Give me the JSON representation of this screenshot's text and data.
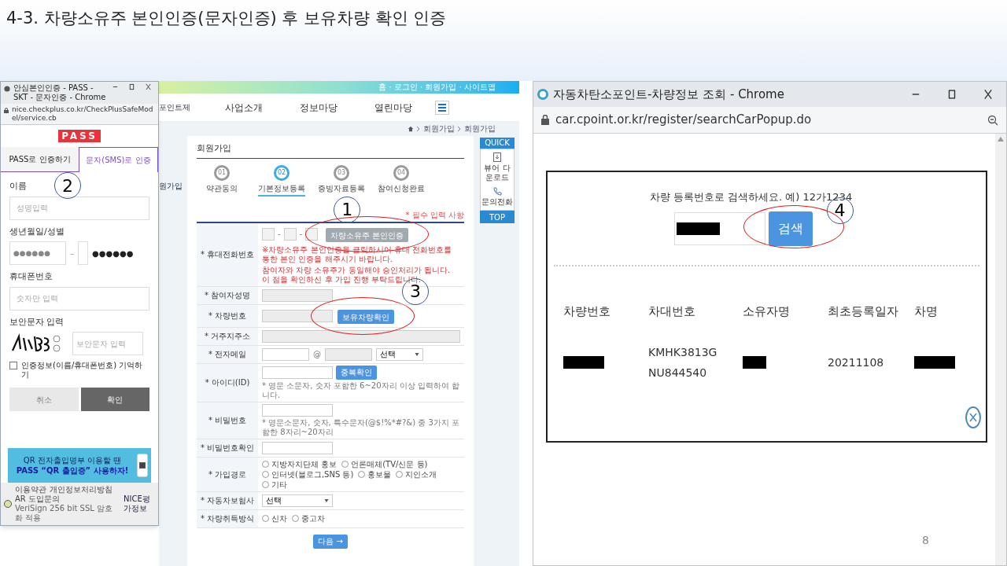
{
  "slide_title": "4-3. 차량소유주 본인인증(문자인증) 후 보유차량 확인 인증",
  "page_number": "8",
  "pass_popup": {
    "title": "안심본인인증 - PASS - SKT - 문자인증 - Chrome",
    "url": "nice.checkplus.co.kr/CheckPlusSafeModel/service.cb",
    "logo": "PASS",
    "marker": "2",
    "tabs": [
      {
        "label": "PASS로 인증하기",
        "selected": false
      },
      {
        "label": "문자(SMS)로 인증",
        "selected": true
      }
    ],
    "fields": [
      {
        "kind": "text",
        "label": "이름",
        "placeholder": "성명입력"
      },
      {
        "kind": "birth",
        "label": "생년월일/성별",
        "placeholder": "●●●●●●",
        "separator": "–",
        "masked": "●●●●●●"
      },
      {
        "kind": "text",
        "label": "휴대폰번호",
        "placeholder": "숫자만 입력"
      },
      {
        "kind": "captcha",
        "label": "보안문자 입력",
        "placeholder": "보안문자 입력"
      }
    ],
    "remember": {
      "label": "인증정보(이름/휴대폰번호) 기억하기",
      "checked": false
    },
    "buttons": [
      {
        "label": "취소",
        "kind": "secondary"
      },
      {
        "label": "확인",
        "kind": "primary"
      }
    ],
    "banner": {
      "line1": "QR 전자출입명부 이용할 땐",
      "line2": "PASS “QR 출입증” 사용하자!"
    },
    "footer": {
      "links": [
        "이용약관",
        "개인정보처리방침",
        "AR 도입문의"
      ],
      "ssl": "VeriSign 256 bit SSL 암호화 적용",
      "brand": "NICE평가정보"
    }
  },
  "site": {
    "top_links": "홈 · 로그인 · 회원가입 · 사이트맵",
    "nav": [
      "포인트제",
      "사업소개",
      "정보마당",
      "열린마당"
    ],
    "breadcrumb": [
      "회원가입",
      "회원가입"
    ],
    "side_title": "원가입",
    "heading": "회원가입",
    "steps": [
      {
        "number": "01",
        "label": "약관동의",
        "selected": false
      },
      {
        "number": "02",
        "label": "기본정보등록",
        "selected": true
      },
      {
        "number": "03",
        "label": "증빙자료등록",
        "selected": false
      },
      {
        "number": "04",
        "label": "참여신청완료",
        "selected": false
      }
    ],
    "quick": {
      "title": "QUICK",
      "items": [
        "뷰어 다운로드",
        "문의전화"
      ],
      "top": "TOP"
    },
    "required_note": "* 필수 입력 사항",
    "rows": [
      {
        "label": "* 휴대전화번호",
        "kind": "phone",
        "separator": "-",
        "button": {
          "label": "차량소유주 본인인증",
          "disabled": true
        },
        "marker": "1",
        "notes": [
          "※차량소유주 본인인증을 클릭하시어 휴대 전화번호를 통한 본인 인증을 해주시기 바랍니다.",
          "참여자와 차량 소유주가 동일해야 승인처리가 됩니다. 이 점을 확인하신 후 가입 진행 부탁드립니다."
        ]
      },
      {
        "label": "* 참여자성명",
        "kind": "readonly"
      },
      {
        "label": "* 차량번호",
        "kind": "readonly",
        "button": {
          "label": "보유차량확인",
          "disabled": false
        },
        "marker": "3"
      },
      {
        "label": "* 거주지주소",
        "kind": "wide"
      },
      {
        "label": "* 전자메일",
        "kind": "email",
        "at": "@",
        "select": "선택"
      },
      {
        "label": "* 아이디(ID)",
        "kind": "input",
        "button": {
          "label": "중복확인",
          "disabled": false
        },
        "hint": "* 영문 소문자, 숫자 포함한 6~20자리 이상 입력하여 합니다."
      },
      {
        "label": "* 비밀번호",
        "kind": "input",
        "hint": "* 영문소문자, 숫자, 특수문자(@$!%*#?&) 중 3가지 포함한 8자리~20자리"
      },
      {
        "label": "* 비밀번호확인",
        "kind": "input"
      },
      {
        "label": "* 가입경로",
        "kind": "radios",
        "options": [
          {
            "label": "지방자치단체 홍보",
            "selected": false
          },
          {
            "label": "언론매체(TV/신문 등)",
            "selected": false
          },
          {
            "label": "인터넷(블로그,SNS 등)",
            "selected": false
          },
          {
            "label": "홍보물",
            "selected": false
          },
          {
            "label": "지인소개",
            "selected": false
          },
          {
            "label": "기타",
            "selected": false
          }
        ]
      },
      {
        "label": "* 자동차보험사",
        "kind": "select",
        "select": "선택"
      },
      {
        "label": "* 차량취득방식",
        "kind": "radios",
        "options": [
          {
            "label": "신차",
            "selected": false
          },
          {
            "label": "중고차",
            "selected": false
          }
        ]
      }
    ],
    "next_button": "다음 →"
  },
  "car_popup": {
    "title": "자동차탄소포인트-차량정보 조회 - Chrome",
    "url": "car.cpoint.or.kr/register/searchCarPopup.do",
    "prompt": "차량 등록번호로 검색하세요. 예) 12가1234",
    "search_field": {
      "kind": "redacted"
    },
    "search_button": "검색",
    "marker": "4",
    "columns": [
      "차량번호",
      "차대번호",
      "소유자명",
      "최초등록일자",
      "차명"
    ],
    "rows": [
      {
        "cells": [
          {
            "kind": "redacted"
          },
          {
            "kind": "text",
            "text": "KMHK3813GNU844540"
          },
          {
            "kind": "redacted"
          },
          {
            "kind": "text",
            "text": "20211108"
          },
          {
            "kind": "redacted"
          }
        ]
      }
    ]
  }
}
